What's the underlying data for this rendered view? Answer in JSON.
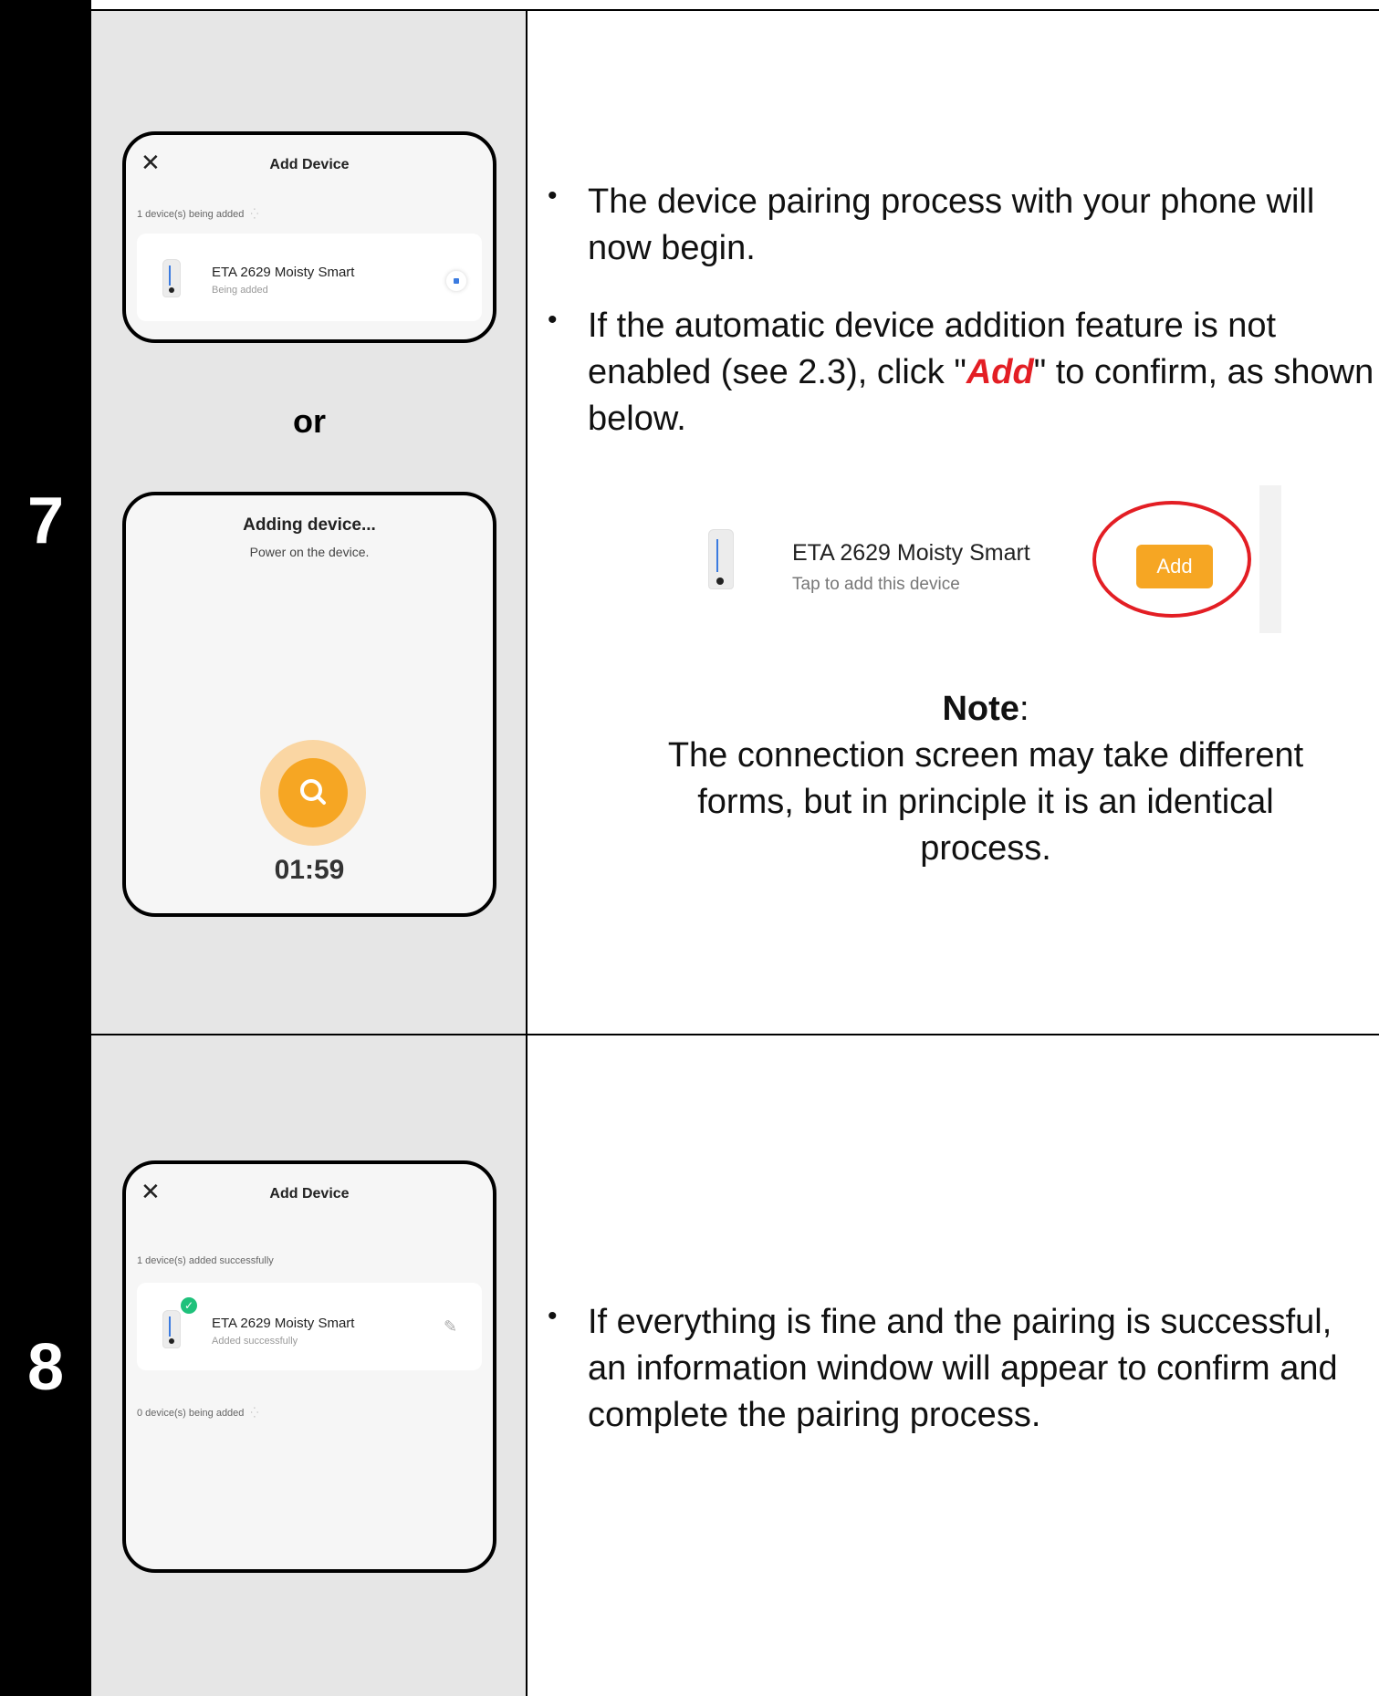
{
  "steps": [
    {
      "number": "7",
      "screen1": {
        "title": "Add Device",
        "status": "1 device(s) being added",
        "device_name": "ETA 2629 Moisty Smart",
        "device_status": "Being added"
      },
      "or_label": "or",
      "screen2": {
        "title": "Adding device...",
        "subtitle": "Power on the device.",
        "timer": "01:59"
      },
      "bullets": [
        "The device pairing process with your phone will now begin.",
        {
          "before": "If the automatic device addition feature is not enabled (see 2.3), click \"",
          "emph": "Add",
          "after": "\" to confirm, as shown below."
        }
      ],
      "add_example": {
        "device_name": "ETA 2629 Moisty Smart",
        "device_sub": "Tap to add this device",
        "button_label": "Add"
      },
      "note": {
        "heading": "Note",
        "colon": ":",
        "body": "The connection screen may take different forms, but in principle it is an identical process."
      }
    },
    {
      "number": "8",
      "screen": {
        "title": "Add Device",
        "status_added": "1 device(s) added successfully",
        "device_name": "ETA 2629 Moisty Smart",
        "device_status": "Added successfully",
        "status_pending": "0 device(s) being added"
      },
      "bullets": [
        "If everything is fine and the pairing is successful, an information window will appear to confirm and complete the pairing process."
      ]
    }
  ],
  "colors": {
    "accent_orange": "#f6a623",
    "highlight_red": "#e31e24",
    "success_green": "#1fc17b",
    "blue": "#3b7be0"
  }
}
